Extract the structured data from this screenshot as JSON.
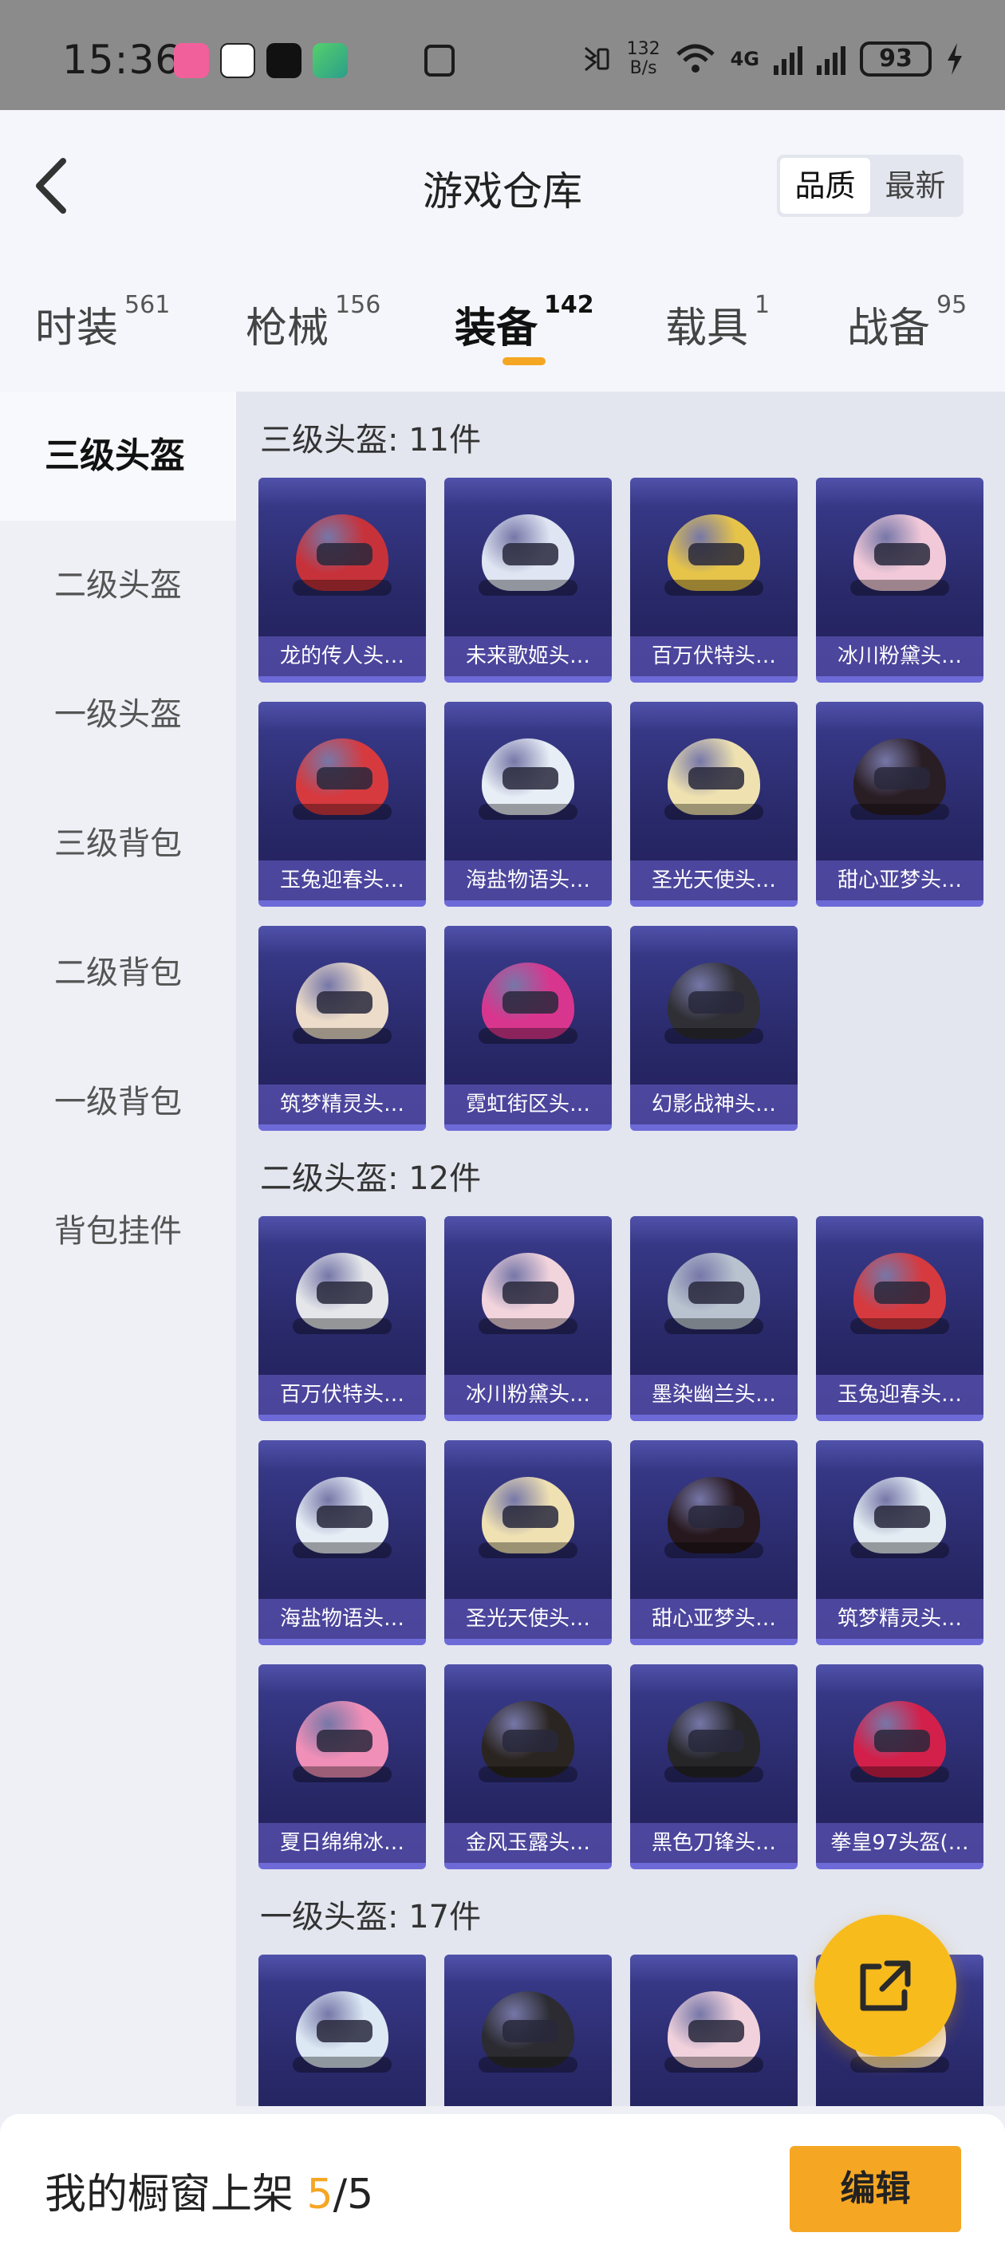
{
  "status_bar": {
    "time": "15:36",
    "net_speed_top": "132",
    "net_speed_bottom": "B/s",
    "battery": "93",
    "network": "4G",
    "app_icons": [
      "bilibili-icon",
      "qq-icon",
      "dewu-icon",
      "iqiyi-icon"
    ]
  },
  "header": {
    "title": "游戏仓库",
    "sort_options": [
      "品质",
      "最新"
    ],
    "sort_active": "品质"
  },
  "tabs": [
    {
      "label": "时装",
      "count": "561"
    },
    {
      "label": "枪械",
      "count": "156"
    },
    {
      "label": "装备",
      "count": "142"
    },
    {
      "label": "载具",
      "count": "1"
    },
    {
      "label": "战备",
      "count": "95"
    }
  ],
  "active_tab": "装备",
  "sidebar": {
    "items": [
      "三级头盔",
      "二级头盔",
      "一级头盔",
      "三级背包",
      "二级背包",
      "一级背包",
      "背包挂件"
    ],
    "active": "三级头盔"
  },
  "sections": [
    {
      "title": "三级头盔: 11件",
      "items": [
        {
          "name": "龙的传人头…",
          "color": "#c7323a"
        },
        {
          "name": "未来歌姬头…",
          "color": "#dfe5f2"
        },
        {
          "name": "百万伏特头…",
          "color": "#e6c44a"
        },
        {
          "name": "冰川粉黛头…",
          "color": "#f1c9d8"
        },
        {
          "name": "玉兔迎春头…",
          "color": "#d63a3f"
        },
        {
          "name": "海盐物语头…",
          "color": "#e8eef6"
        },
        {
          "name": "圣光天使头…",
          "color": "#efe2b0"
        },
        {
          "name": "甜心亚梦头…",
          "color": "#2a1e25"
        },
        {
          "name": "筑梦精灵头…",
          "color": "#ecdcc9"
        },
        {
          "name": "霓虹街区头…",
          "color": "#d8368e"
        },
        {
          "name": "幻影战神头…",
          "color": "#2f2f35"
        }
      ]
    },
    {
      "title": "二级头盔: 12件",
      "items": [
        {
          "name": "百万伏特头…",
          "color": "#e4e6ea"
        },
        {
          "name": "冰川粉黛头…",
          "color": "#f2d4dc"
        },
        {
          "name": "墨染幽兰头…",
          "color": "#b9c3cf"
        },
        {
          "name": "玉兔迎春头…",
          "color": "#d63a3f"
        },
        {
          "name": "海盐物语头…",
          "color": "#e6edf5"
        },
        {
          "name": "圣光天使头…",
          "color": "#efe1b2"
        },
        {
          "name": "甜心亚梦头…",
          "color": "#26181d"
        },
        {
          "name": "筑梦精灵头…",
          "color": "#e3ecf2"
        },
        {
          "name": "夏日绵绵冰…",
          "color": "#f08fb7"
        },
        {
          "name": "金风玉露头…",
          "color": "#2a2520"
        },
        {
          "name": "黑色刀锋头…",
          "color": "#262629"
        },
        {
          "name": "拳皇97头盔(…",
          "color": "#d3204a"
        }
      ]
    },
    {
      "title": "一级头盔: 17件",
      "items": [
        {
          "name": "",
          "color": "#dce8f4"
        },
        {
          "name": "",
          "color": "#2b2b31"
        },
        {
          "name": "",
          "color": "#f1d2dc"
        },
        {
          "name": "",
          "color": "#f4e1c8"
        }
      ]
    }
  ],
  "bottom_bar": {
    "label": "我的橱窗上架 ",
    "current": "5",
    "total": "/5",
    "edit_label": "编辑"
  }
}
